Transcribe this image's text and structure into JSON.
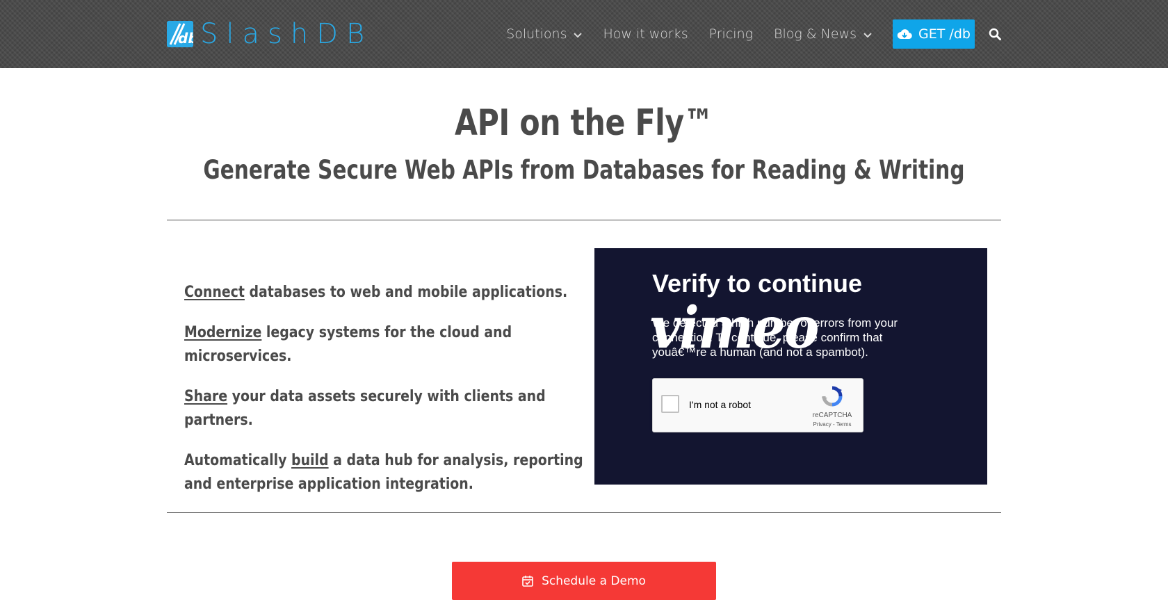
{
  "header": {
    "logo_text": "SlashDB",
    "nav": [
      {
        "label": "Solutions",
        "has_dropdown": true
      },
      {
        "label": "How it works",
        "has_dropdown": false
      },
      {
        "label": "Pricing",
        "has_dropdown": false
      },
      {
        "label": "Blog & News",
        "has_dropdown": true
      }
    ],
    "cta_label": "GET /db",
    "cta_icon": "cloud-download-icon",
    "search_icon": "search-icon"
  },
  "hero": {
    "title": "API on the Fly™",
    "subtitle": "Generate Secure Web APIs from Databases for Reading & Writing"
  },
  "features": [
    {
      "prefix": "",
      "keyword": "Connect",
      "rest": " databases to web and mobile applications."
    },
    {
      "prefix": "",
      "keyword": "Modernize",
      "rest": " legacy systems for the cloud and microservices."
    },
    {
      "prefix": "",
      "keyword": "Share",
      "rest": " your data assets securely with clients and partners."
    },
    {
      "prefix": "Automatically ",
      "keyword": "build",
      "rest": " a data hub for analysis, reporting and enterprise application integration."
    }
  ],
  "video": {
    "verify_title": "Verify to continue",
    "verify_body": "We detected a high number of errors from your connection. To continue, please confirm that youâ€™re a human (and not a spambot).",
    "vimeo_logo": "vimeo",
    "recaptcha": {
      "label": "I'm not a robot",
      "brand": "reCAPTCHA",
      "terms": "Privacy - Terms"
    }
  },
  "cta": {
    "label": "Schedule a Demo",
    "icon": "calendar-check-icon"
  },
  "colors": {
    "brand_blue": "#0fa5e9",
    "cta_red": "#f53936",
    "video_bg": "#131530",
    "text_dark": "#4a4a4a"
  }
}
